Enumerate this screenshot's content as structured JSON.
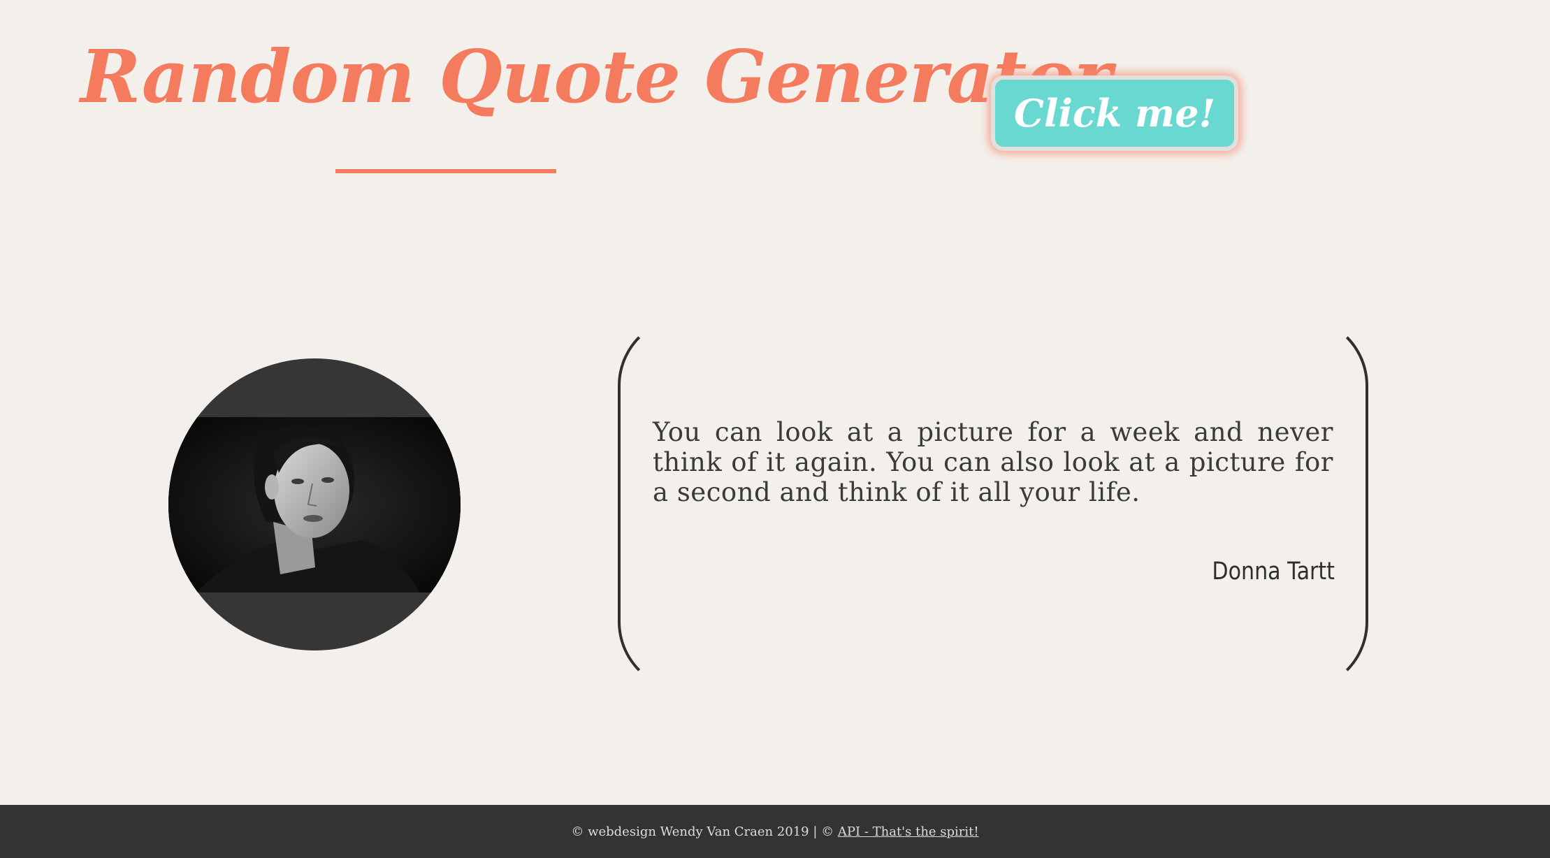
{
  "header": {
    "title": "Random Quote Generator",
    "button_label": "Click me!"
  },
  "quote": {
    "text": "You can look at a picture for a week and never think of it again. You can also look at a picture for a second and think of it all your life.",
    "author": "Donna Tartt"
  },
  "footer": {
    "credit": "© webdesign Wendy Van Craen 2019 | © ",
    "api_link": "API - That's the spirit!"
  },
  "colors": {
    "accent": "#f47b5d",
    "button": "#68d8d0",
    "background": "#f3f0eb",
    "footer": "#333333"
  }
}
